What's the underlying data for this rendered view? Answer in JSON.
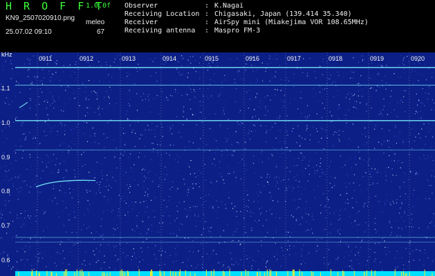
{
  "header": {
    "app_title": "H R O F F T",
    "version": "1.0.0f",
    "file_name": "KN9_2507020910.png",
    "meleo_label": "meleo",
    "datetime": "25.07.02 09:10",
    "meleo_count": "67"
  },
  "info": [
    {
      "key": "Observer",
      "sep": ":",
      "value": "K.Nagai"
    },
    {
      "key": "Receiving Location",
      "sep": ":",
      "value": "Chigasaki, Japan (139.414 35.340)"
    },
    {
      "key": "Receiver",
      "sep": ":",
      "value": "AirSpy mini (Miakejima VOR 108.65MHz)"
    },
    {
      "key": "Receiving antenna",
      "sep": ":",
      "value": "Maspro FM-3"
    }
  ],
  "axis": {
    "y_unit": "kHz",
    "y_ticks": [
      "1.1",
      "1.0",
      "0.9",
      "0.8",
      "0.7",
      "0.6"
    ],
    "x_ticks": [
      "0911",
      "0912",
      "0913",
      "0914",
      "0915",
      "0916",
      "0917",
      "0918",
      "0919",
      "0920"
    ]
  },
  "colors": {
    "background": "#0c1f86",
    "carrier": "#7cf0ff",
    "header_title": "#3cff3c",
    "text": "#f0f0f0",
    "meteor_marks": "#ffee22",
    "baseline": "#00dfff"
  }
}
